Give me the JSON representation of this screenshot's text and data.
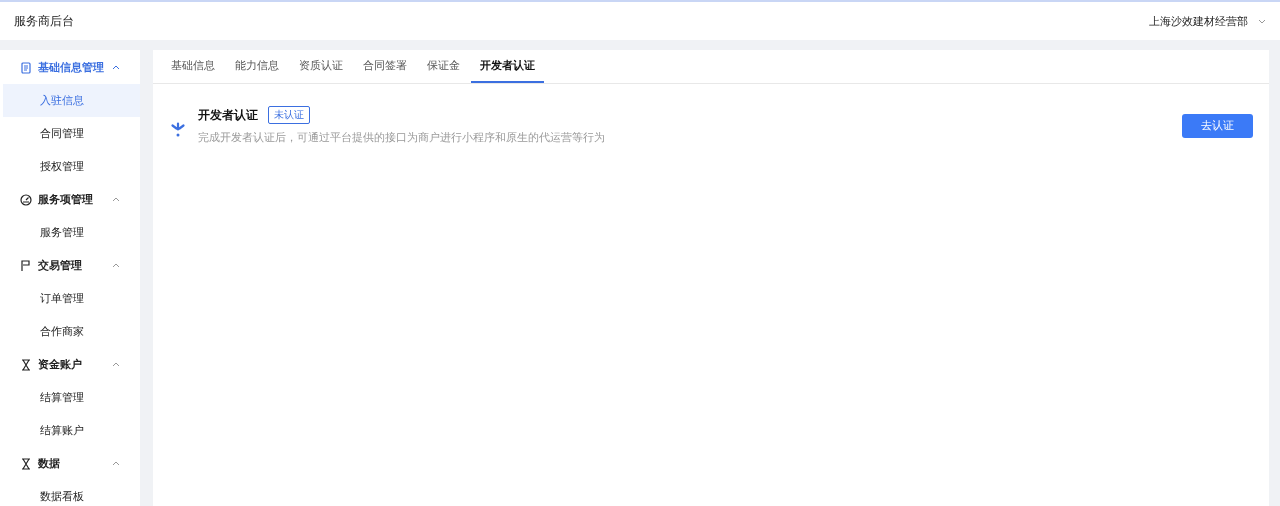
{
  "header": {
    "title": "服务商后台",
    "account": "上海沙效建材经营部"
  },
  "sidebar": {
    "groups": [
      {
        "label": "基础信息管理",
        "kind": "document",
        "selected": true,
        "expanded": true,
        "children": [
          {
            "label": "入驻信息",
            "selected": true
          },
          {
            "label": "合同管理",
            "selected": false
          },
          {
            "label": "授权管理",
            "selected": false
          }
        ]
      },
      {
        "label": "服务项管理",
        "kind": "gauge",
        "selected": false,
        "expanded": true,
        "children": [
          {
            "label": "服务管理",
            "selected": false
          }
        ]
      },
      {
        "label": "交易管理",
        "kind": "flag",
        "selected": false,
        "expanded": true,
        "children": [
          {
            "label": "订单管理",
            "selected": false
          },
          {
            "label": "合作商家",
            "selected": false
          }
        ]
      },
      {
        "label": "资金账户",
        "kind": "hourglass",
        "selected": false,
        "expanded": true,
        "children": [
          {
            "label": "结算管理",
            "selected": false
          },
          {
            "label": "结算账户",
            "selected": false
          }
        ]
      },
      {
        "label": "数据",
        "kind": "hourglass",
        "selected": false,
        "expanded": true,
        "children": [
          {
            "label": "数据看板",
            "selected": false
          }
        ]
      }
    ]
  },
  "tabs": [
    {
      "label": "基础信息",
      "selected": false
    },
    {
      "label": "能力信息",
      "selected": false
    },
    {
      "label": "资质认证",
      "selected": false
    },
    {
      "label": "合同签署",
      "selected": false
    },
    {
      "label": "保证金",
      "selected": false
    },
    {
      "label": "开发者认证",
      "selected": true
    }
  ],
  "certification": {
    "title": "开发者认证",
    "status": "未认证",
    "description": "完成开发者认证后，可通过平台提供的接口为商户进行小程序和原生的代运营等行为",
    "button": "去认证"
  }
}
